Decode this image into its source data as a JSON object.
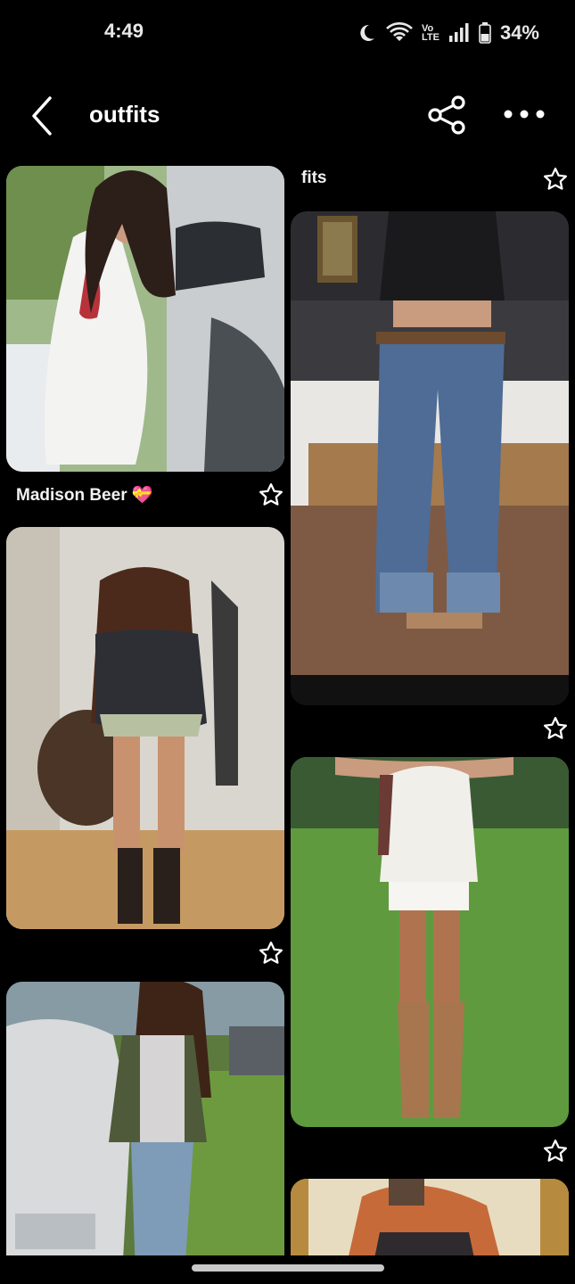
{
  "status_bar": {
    "time": "4:49",
    "volte": "Vo\nLTE",
    "battery": "34%"
  },
  "header": {
    "title": "outfits"
  },
  "pins": {
    "left": [
      {
        "caption": "Madison Beer",
        "emoji": "💝"
      },
      {
        "caption": ""
      },
      {
        "caption": ""
      }
    ],
    "right": [
      {
        "caption": "fits"
      },
      {
        "caption": ""
      },
      {
        "caption": ""
      },
      {
        "caption": ""
      }
    ]
  },
  "colors": {
    "background": "#000000",
    "text": "#ffffff"
  },
  "icons": [
    "back-arrow-icon",
    "share-icon",
    "more-icon",
    "star-icon",
    "moon-icon",
    "wifi-icon",
    "signal-icon",
    "battery-icon"
  ]
}
